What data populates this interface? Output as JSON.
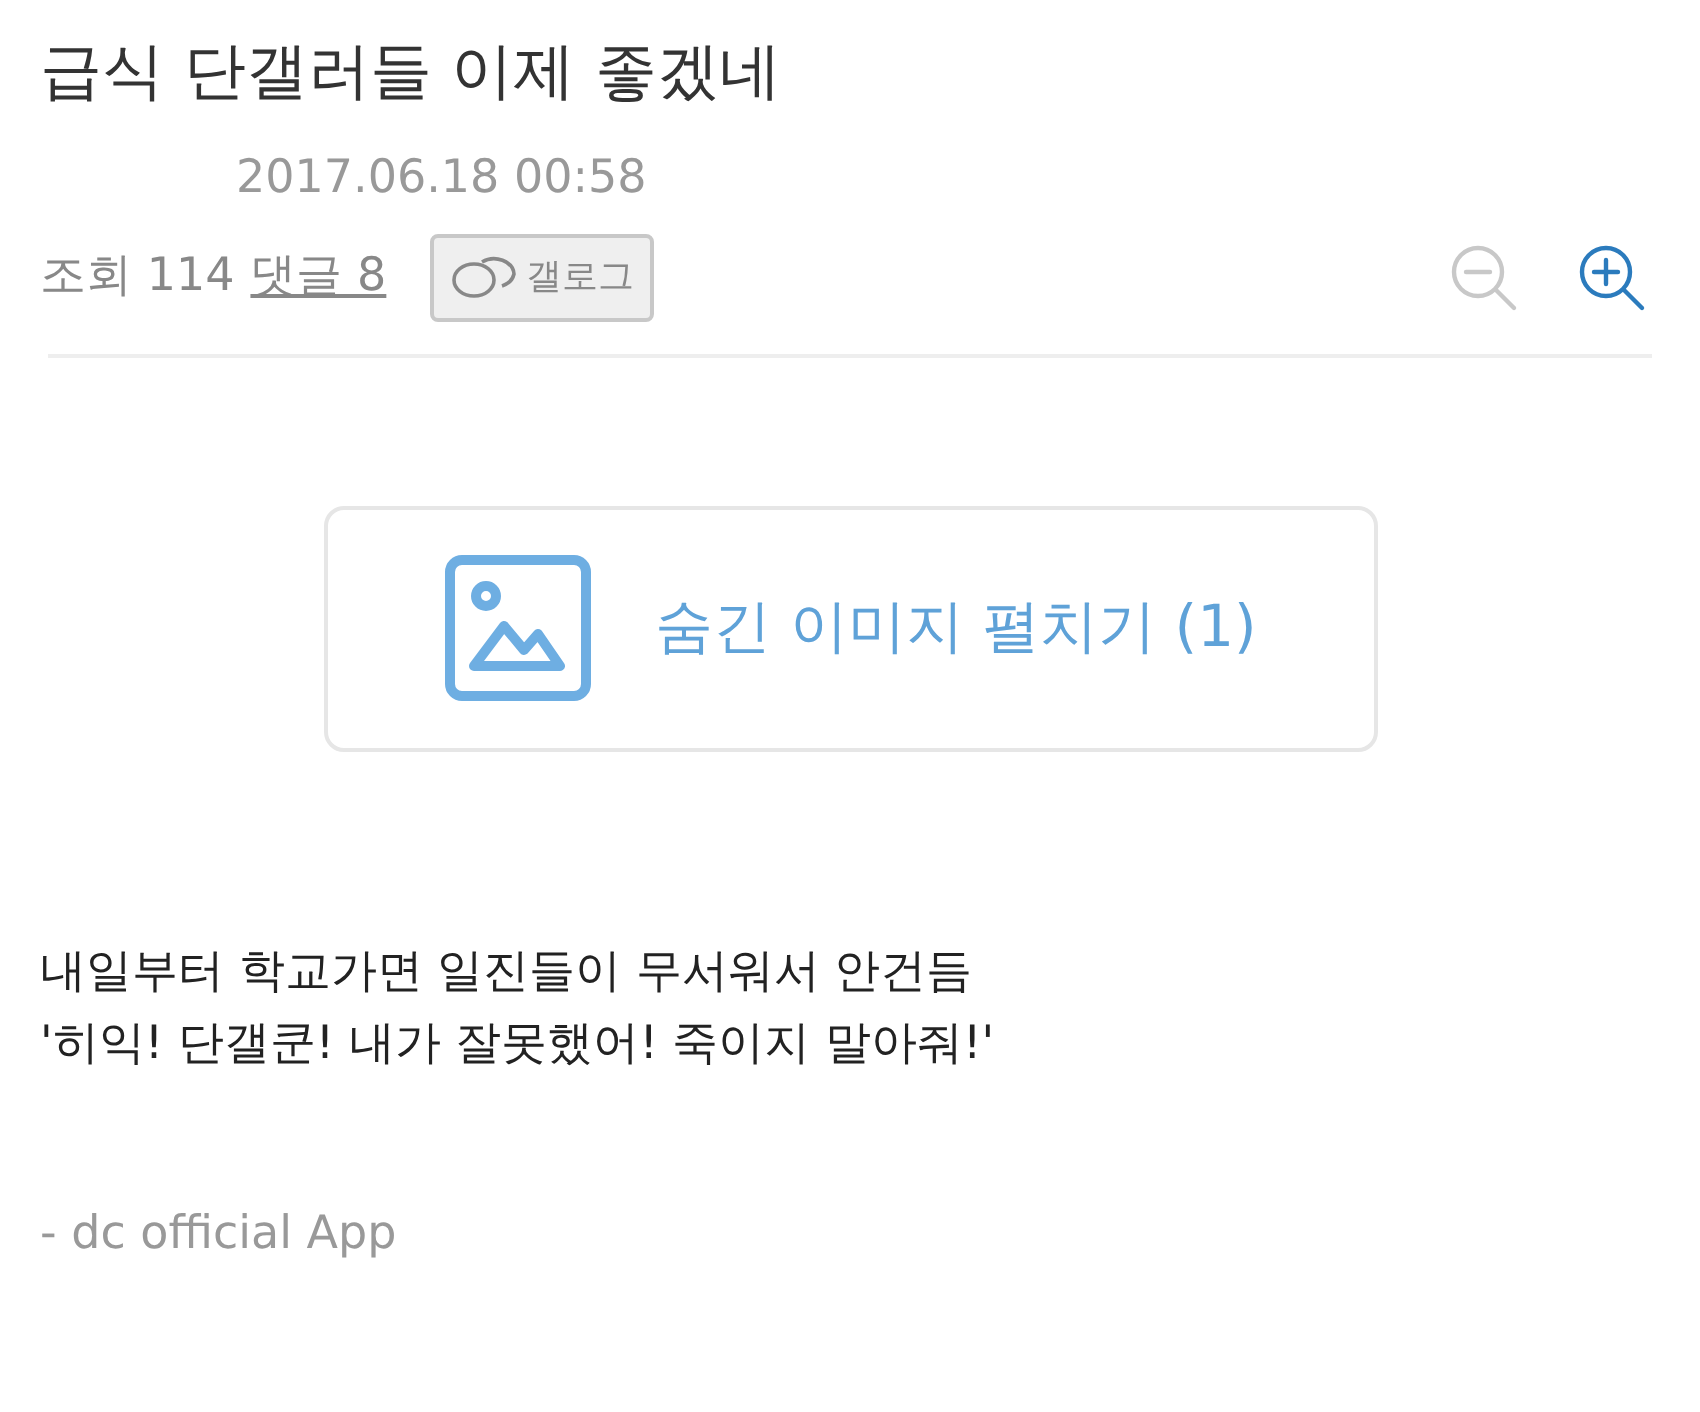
{
  "post": {
    "title": "급식 단갤러들 이제 좋겠네",
    "date": "2017.06.18 00:58",
    "views_label": "조회",
    "views": "114",
    "comments_label": "댓글 8",
    "gallog": "갤로그"
  },
  "zoom": [
    {
      "kind": "out",
      "disabled": true
    },
    {
      "kind": "in",
      "disabled": false
    }
  ],
  "hidden_images": {
    "label": "숨긴 이미지 펼치기 (1)"
  },
  "body": [
    "내일부터 학교가면 일진들이 무서워서 안건듬",
    "'히익! 단갤쿤! 내가 잘못했어! 죽이지 말아줘!'"
  ],
  "footer": "- dc official App"
}
